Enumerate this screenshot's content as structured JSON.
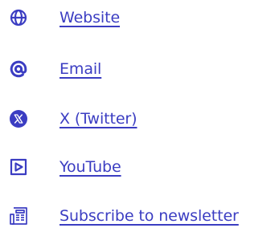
{
  "accent_color": "#3b3dc2",
  "links": [
    {
      "label": "Website",
      "icon": "globe-icon"
    },
    {
      "label": "Email",
      "icon": "at-sign-icon"
    },
    {
      "label": "X (Twitter)",
      "icon": "x-logo-icon"
    },
    {
      "label": "YouTube",
      "icon": "play-box-icon"
    },
    {
      "label": "Subscribe to newsletter",
      "icon": "newspaper-icon"
    }
  ]
}
